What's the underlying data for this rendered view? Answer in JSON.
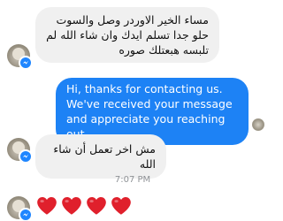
{
  "messages": [
    {
      "side": "incoming",
      "text": "مساء الخير الاوردر وصل والسوت حلو جدا تسلم ايدك وان شاء الله لم تلبسه هبعتلك صوره"
    },
    {
      "side": "outgoing",
      "text": "Hi, thanks for contacting us. We've received your message and appreciate you reaching out."
    },
    {
      "side": "incoming",
      "text": "مش اخر تعمل أن شاء الله"
    }
  ],
  "timestamp": "7:07 PM",
  "reaction": {
    "icon": "red-heart-icon",
    "count": 4,
    "color": "#e0202c"
  },
  "colors": {
    "outgoing_bubble": "#1d82f5",
    "incoming_bubble": "#f0f0f0",
    "messenger_badge": "#1f86ff"
  }
}
